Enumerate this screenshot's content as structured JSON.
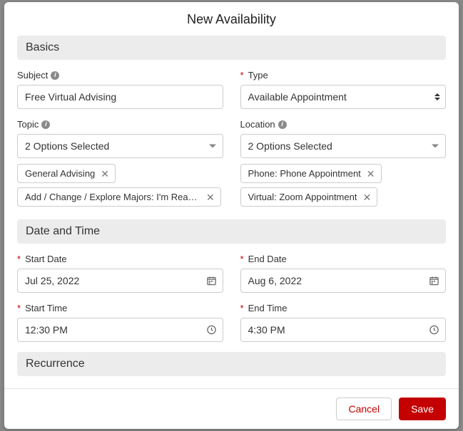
{
  "modal": {
    "title": "New Availability"
  },
  "sections": {
    "basics": "Basics",
    "datetime": "Date and Time",
    "recurrence": "Recurrence"
  },
  "basics": {
    "subject": {
      "label": "Subject",
      "value": "Free Virtual Advising"
    },
    "type": {
      "label": "Type",
      "required": true,
      "selected": "Available Appointment"
    },
    "topic": {
      "label": "Topic",
      "summary": "2 Options Selected",
      "chips": [
        "General Advising",
        "Add / Change / Explore Majors: I'm Ready ..."
      ]
    },
    "location": {
      "label": "Location",
      "summary": "2 Options Selected",
      "chips": [
        "Phone: Phone Appointment",
        "Virtual: Zoom Appointment"
      ]
    }
  },
  "datetime": {
    "start_date": {
      "label": "Start Date",
      "value": "Jul 25, 2022",
      "required": true
    },
    "end_date": {
      "label": "End Date",
      "value": "Aug 6, 2022",
      "required": true
    },
    "start_time": {
      "label": "Start Time",
      "value": "12:30 PM",
      "required": true
    },
    "end_time": {
      "label": "End Time",
      "value": "4:30 PM",
      "required": true
    }
  },
  "footer": {
    "cancel": "Cancel",
    "save": "Save"
  }
}
